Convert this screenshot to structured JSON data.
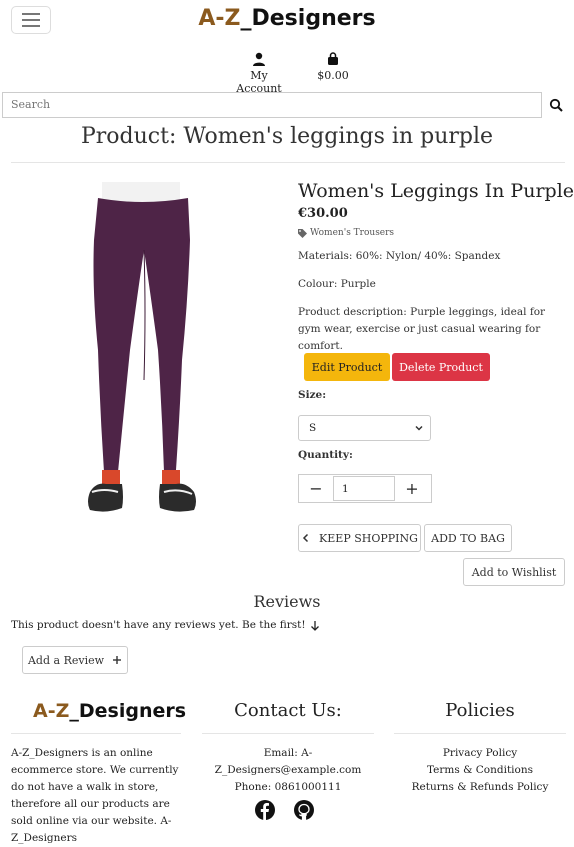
{
  "header": {
    "brand_az": "A-Z",
    "brand_rest": "_Designers",
    "account_label": "My Account",
    "bag_total": "$0.00",
    "search_placeholder": "Search"
  },
  "page_title": "Product: Women's leggings in purple",
  "product": {
    "name": "Women's Leggings In Purple",
    "price": "€30.00",
    "category": "Women's Trousers",
    "materials": "Materials: 60%: Nylon/ 40%: Spandex",
    "colour": "Colour: Purple",
    "description": "Product description: Purple leggings, ideal for gym wear, exercise or just casual wearing for comfort.",
    "edit_label": "Edit Product",
    "delete_label": "Delete Product",
    "size_label": "Size:",
    "size_value": "S",
    "quantity_label": "Quantity:",
    "quantity_value": "1",
    "minus": "−",
    "plus": "+",
    "keep_shopping": "KEEP SHOPPING",
    "add_to_bag": "ADD TO BAG",
    "add_to_wishlist": "Add to Wishlist"
  },
  "reviews": {
    "title": "Reviews",
    "empty_text": "This product doesn't have any reviews yet. Be the first!",
    "add_label": "Add a Review"
  },
  "footer": {
    "brand_az": "A-Z",
    "brand_rest": "_Designers",
    "about": "A-Z_Designers is an online ecommerce store. We currently do not have a walk in store, therefore all our products are sold online via our website. A-Z_Designers",
    "contact_title": "Contact Us:",
    "email_line1": "Email: A-",
    "email_line2": "Z_Designers@example.com",
    "phone": "Phone: 0861000111",
    "policies_title": "Policies",
    "privacy": "Privacy Policy",
    "terms": "Terms & Conditions",
    "returns": "Returns & Refunds Policy"
  },
  "colors": {
    "brand_accent": "#8b5a1e",
    "edit_button": "#f4b60c",
    "delete_button": "#dc3545",
    "product_purple": "#4e2447"
  },
  "icons": [
    "menu-icon",
    "user-icon",
    "shopping-bag-icon",
    "search-icon",
    "tag-icon",
    "chevron-down-icon",
    "chevron-left-icon",
    "arrow-down-icon",
    "plus-icon",
    "facebook-icon",
    "github-icon"
  ]
}
